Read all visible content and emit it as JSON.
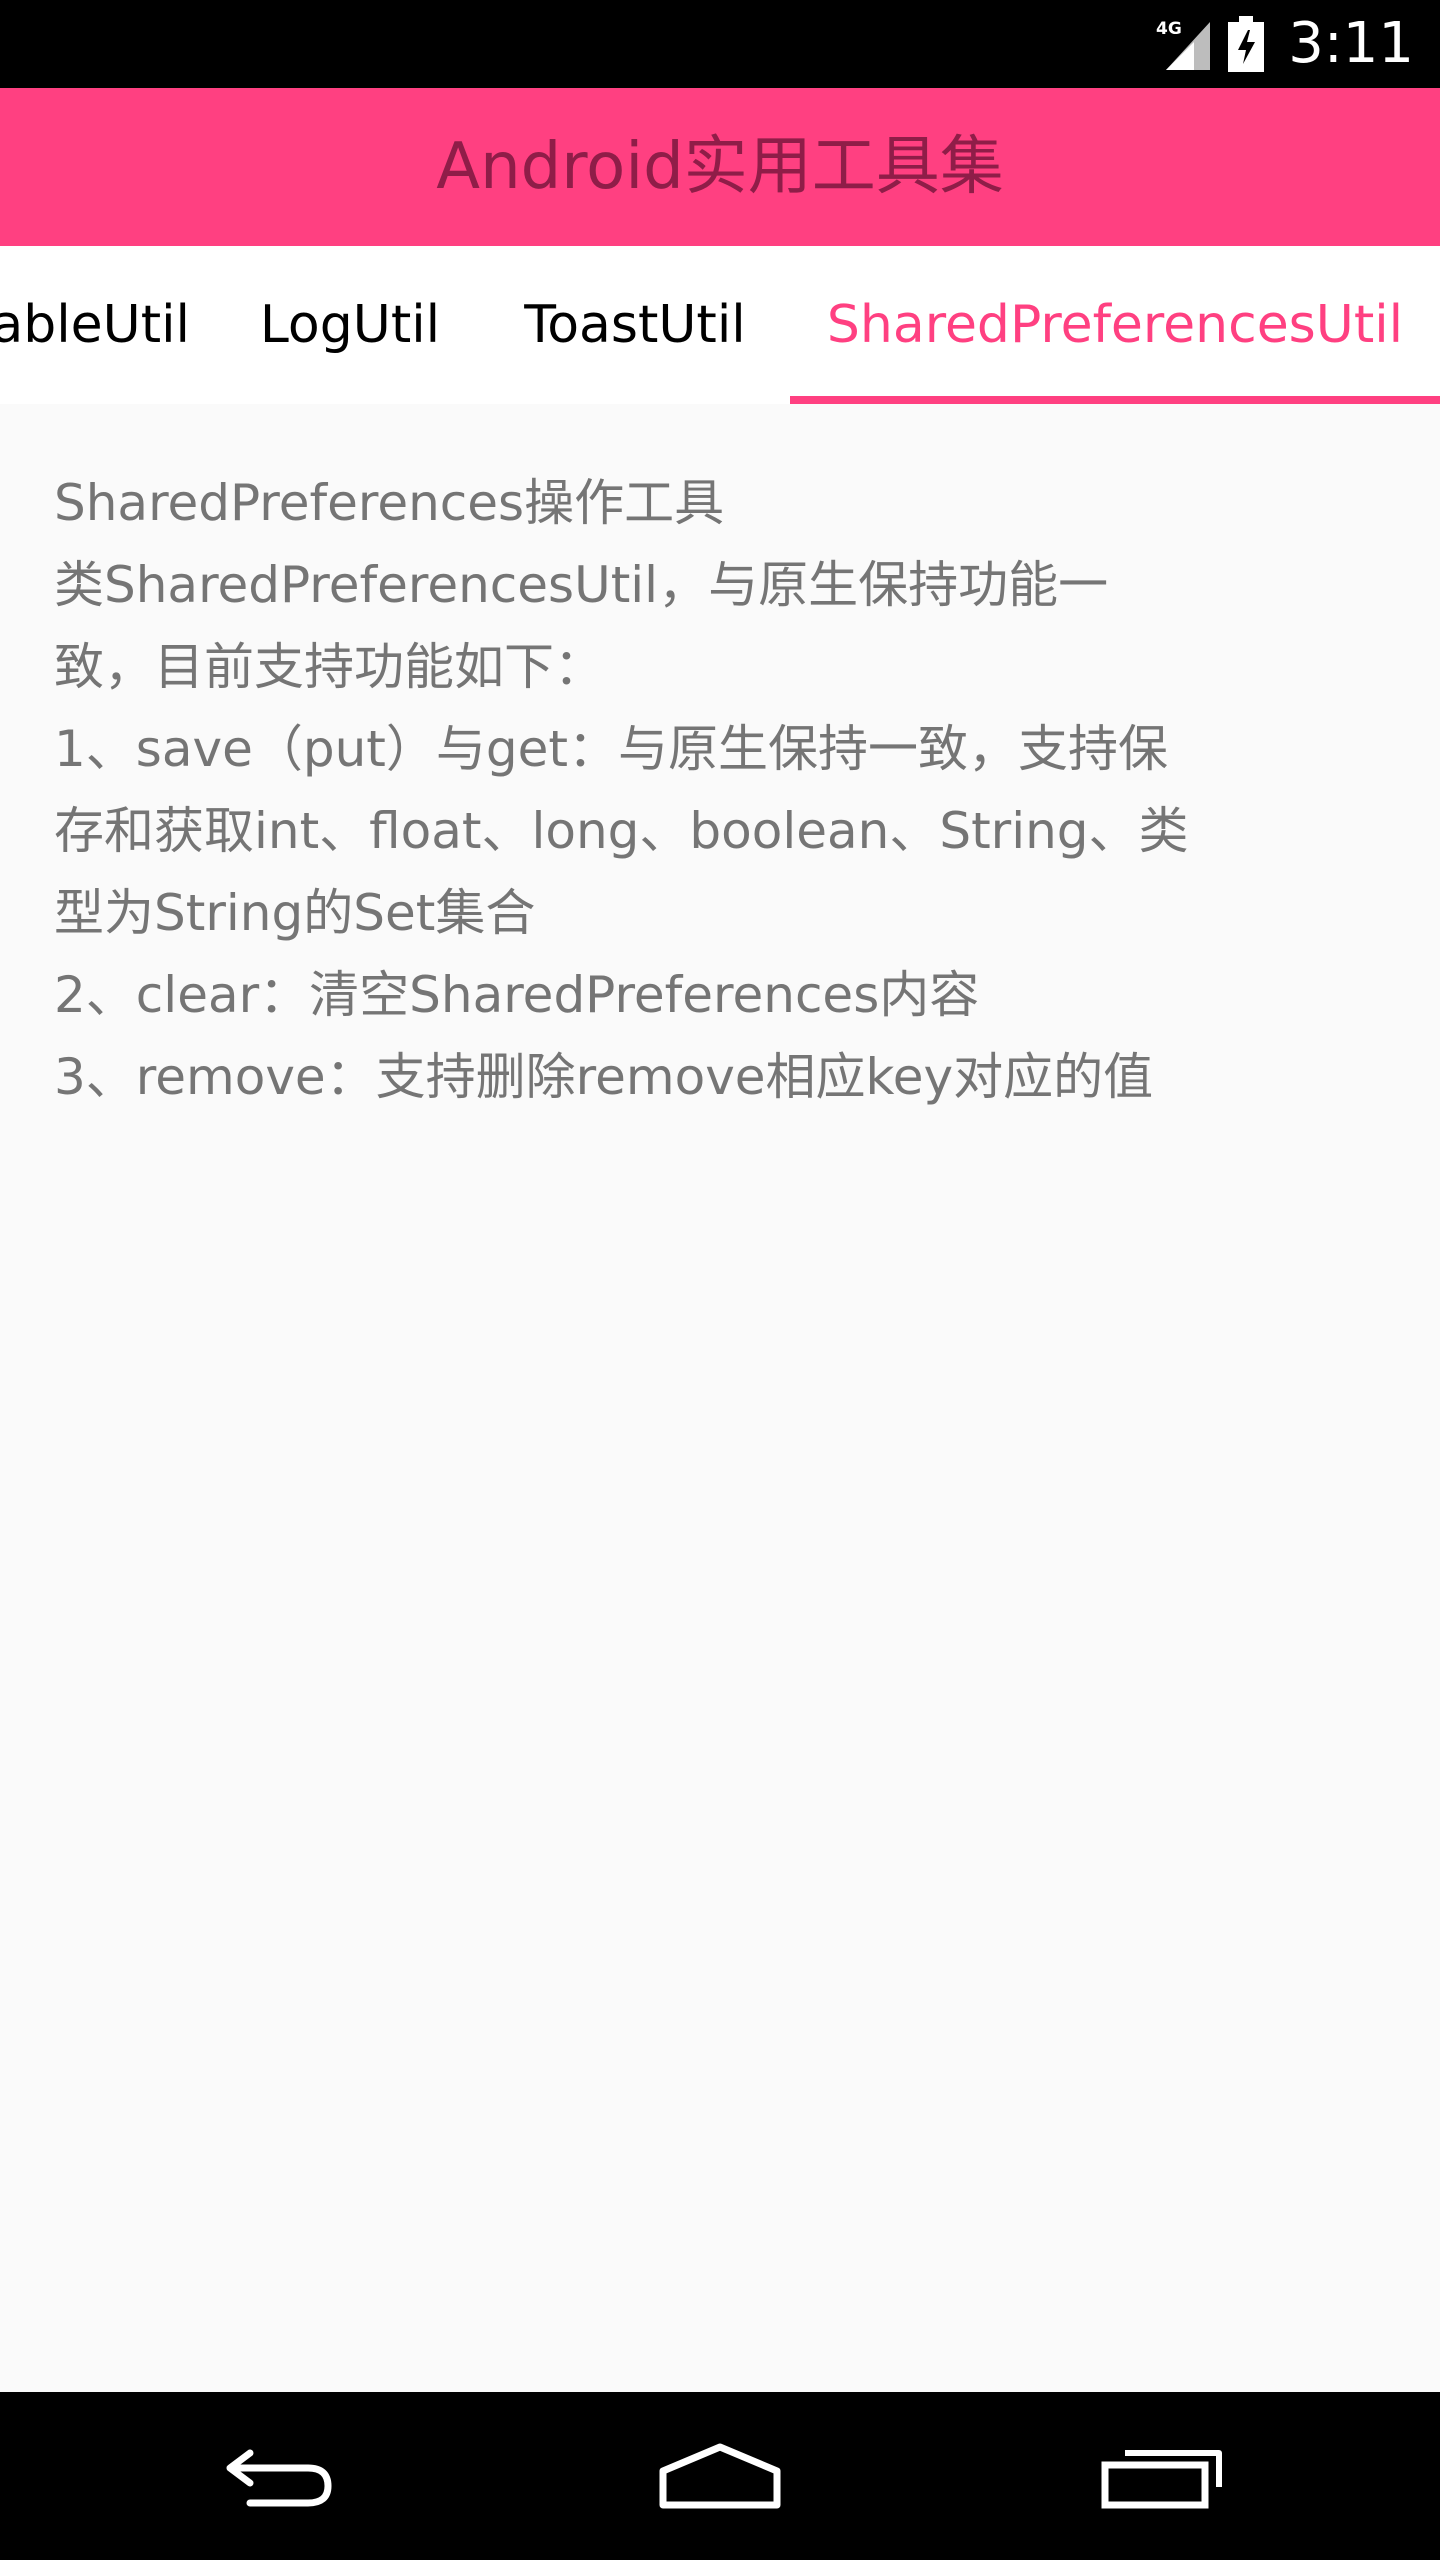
{
  "status_bar": {
    "network": "4G",
    "time": "3:11"
  },
  "app_bar": {
    "title": "Android实用工具集"
  },
  "tabs": [
    {
      "label": "ableUtil",
      "active": false
    },
    {
      "label": "LogUtil",
      "active": false
    },
    {
      "label": "ToastUtil",
      "active": false
    },
    {
      "label": "SharedPreferencesUtil",
      "active": true
    }
  ],
  "content": {
    "lines": [
      "SharedPreferences操作工具",
      "类SharedPreferencesUtil，与原生保持功能一",
      "致，目前支持功能如下：",
      "1、save（put）与get：与原生保持一致，支持保",
      "存和获取int、float、long、boolean、String、类",
      "型为String的Set集合",
      "2、clear：清空SharedPreferences内容",
      "3、remove：支持删除remove相应key对应的值"
    ]
  },
  "nav_bar": {
    "back": "back-icon",
    "home": "home-icon",
    "recents": "recents-icon"
  },
  "colors": {
    "accent": "#ff4081",
    "title_text": "#8f1d48",
    "body_text": "#757575",
    "background": "#fafafa"
  }
}
